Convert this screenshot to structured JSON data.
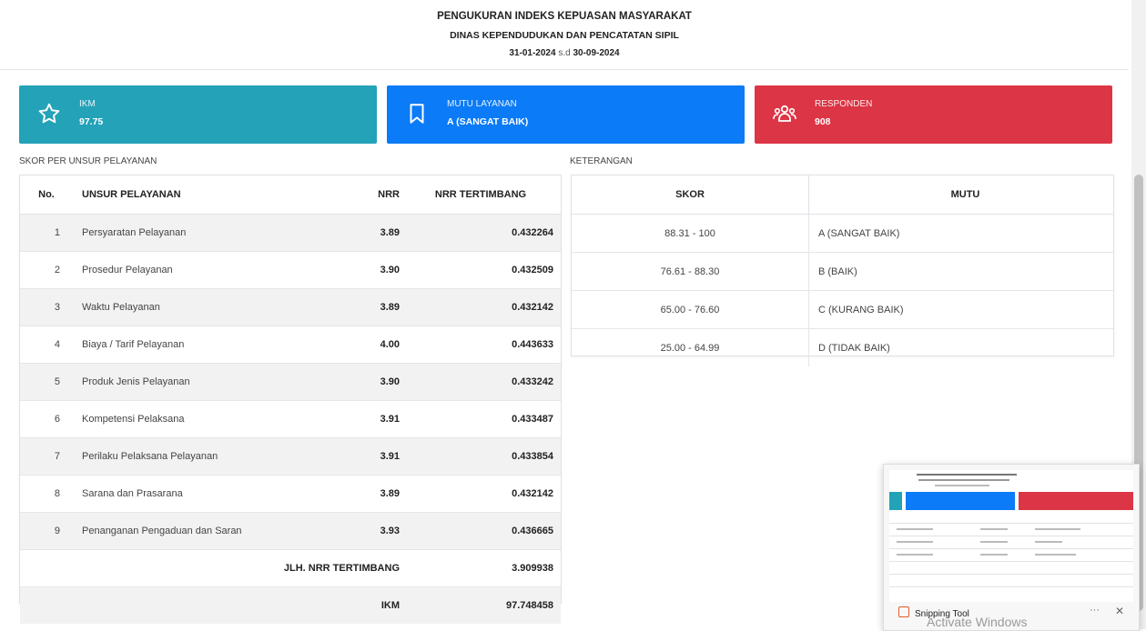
{
  "header": {
    "title": "PENGUKURAN INDEKS KEPUASAN MASYARAKAT",
    "subtitle": "DINAS KEPENDUDUKAN DAN PENCATATAN SIPIL",
    "date_from": "31-01-2024",
    "date_sep": "s.d",
    "date_to": "30-09-2024"
  },
  "cards": {
    "ikm": {
      "label": "IKM",
      "value": "97.75",
      "icon": "star-icon",
      "color": "#23a2b8"
    },
    "mutu": {
      "label": "MUTU LAYANAN",
      "value": "A (SANGAT BAIK)",
      "icon": "bookmark-icon",
      "color": "#0b7bf7"
    },
    "responden": {
      "label": "RESPONDEN",
      "value": "908",
      "icon": "users-icon",
      "color": "#dc3545"
    }
  },
  "skor": {
    "section_title": "SKOR PER UNSUR PELAYANAN",
    "columns": {
      "no": "No.",
      "unsur": "UNSUR PELAYANAN",
      "nrr": "NRR",
      "nrrt": "NRR TERTIMBANG"
    },
    "rows": [
      {
        "no": "1",
        "unsur": "Persyaratan Pelayanan",
        "nrr": "3.89",
        "nrrt": "0.432264"
      },
      {
        "no": "2",
        "unsur": "Prosedur Pelayanan",
        "nrr": "3.90",
        "nrrt": "0.432509"
      },
      {
        "no": "3",
        "unsur": "Waktu Pelayanan",
        "nrr": "3.89",
        "nrrt": "0.432142"
      },
      {
        "no": "4",
        "unsur": "Biaya / Tarif Pelayanan",
        "nrr": "4.00",
        "nrrt": "0.443633"
      },
      {
        "no": "5",
        "unsur": "Produk Jenis Pelayanan",
        "nrr": "3.90",
        "nrrt": "0.433242"
      },
      {
        "no": "6",
        "unsur": "Kompetensi Pelaksana",
        "nrr": "3.91",
        "nrrt": "0.433487"
      },
      {
        "no": "7",
        "unsur": "Perilaku Pelaksana Pelayanan",
        "nrr": "3.91",
        "nrrt": "0.433854"
      },
      {
        "no": "8",
        "unsur": "Sarana dan Prasarana",
        "nrr": "3.89",
        "nrrt": "0.432142"
      },
      {
        "no": "9",
        "unsur": "Penanganan Pengaduan dan Saran",
        "nrr": "3.93",
        "nrrt": "0.436665"
      }
    ],
    "total_label": "JLH. NRR TERTIMBANG",
    "total_value": "3.909938",
    "ikm_label": "IKM",
    "ikm_value": "97.748458"
  },
  "keterangan": {
    "section_title": "KETERANGAN",
    "columns": {
      "skor": "SKOR",
      "mutu": "MUTU"
    },
    "rows": [
      {
        "skor": "88.31 - 100",
        "mutu": "A (SANGAT BAIK)"
      },
      {
        "skor": "76.61 - 88.30",
        "mutu": "B (BAIK)"
      },
      {
        "skor": "65.00 - 76.60",
        "mutu": "C (KURANG BAIK)"
      },
      {
        "skor": "25.00 - 64.99",
        "mutu": "D (TIDAK BAIK)"
      }
    ]
  },
  "notification": {
    "app_name": "Snipping Tool",
    "more": "···",
    "close": "✕"
  },
  "watermark": "Activate Windows"
}
